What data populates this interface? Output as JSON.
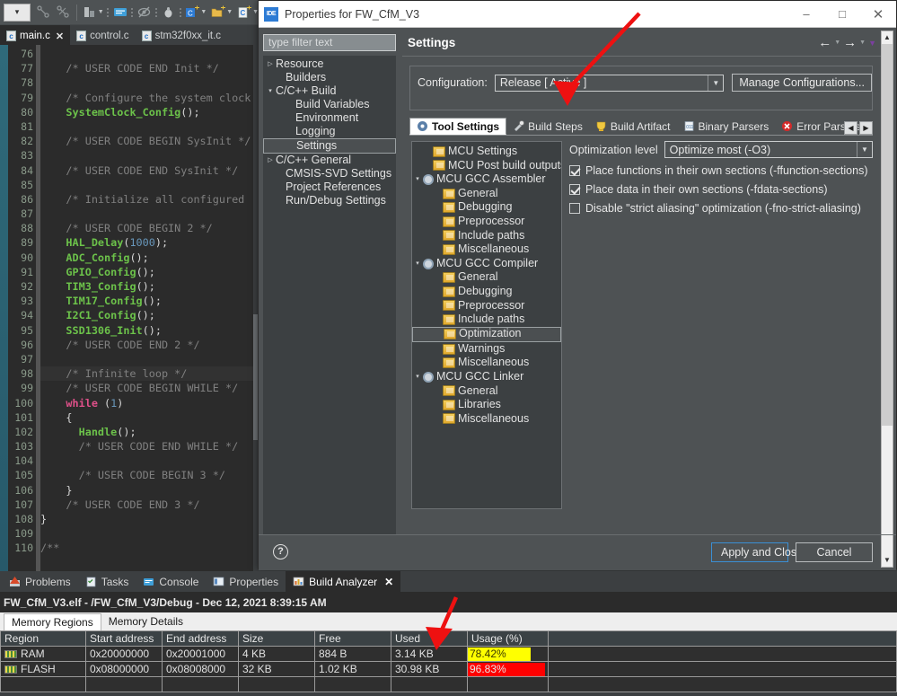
{
  "ide": {
    "toolbar_icons": [
      "perspective-combo",
      "link-with-editor-icon",
      "collapse-all-icon",
      "build-icon",
      "console-icon",
      "hide-icon",
      "debug-icon",
      "new-c-project-icon",
      "new-folder-icon",
      "new-c-file-icon"
    ],
    "tabs": [
      {
        "label": "main.c",
        "active": true,
        "closable": true
      },
      {
        "label": "control.c",
        "active": false,
        "closable": false
      },
      {
        "label": "stm32f0xx_it.c",
        "active": false,
        "closable": false
      }
    ],
    "code": {
      "first_line": 76,
      "lines": [
        {
          "n": 76,
          "text": "",
          "hl": false
        },
        {
          "n": 77,
          "text": "    /* USER CODE END Init */",
          "hl": false
        },
        {
          "n": 78,
          "text": "",
          "hl": false
        },
        {
          "n": 79,
          "text": "    /* Configure the system clock",
          "hl": false
        },
        {
          "n": 80,
          "text": "    SystemClock_Config();",
          "hl": false
        },
        {
          "n": 81,
          "text": "",
          "hl": false
        },
        {
          "n": 82,
          "text": "    /* USER CODE BEGIN SysInit */",
          "hl": false
        },
        {
          "n": 83,
          "text": "",
          "hl": false
        },
        {
          "n": 84,
          "text": "    /* USER CODE END SysInit */",
          "hl": false
        },
        {
          "n": 85,
          "text": "",
          "hl": false
        },
        {
          "n": 86,
          "text": "    /* Initialize all configured",
          "hl": false
        },
        {
          "n": 87,
          "text": "",
          "hl": false
        },
        {
          "n": 88,
          "text": "    /* USER CODE BEGIN 2 */",
          "hl": false
        },
        {
          "n": 89,
          "text": "    HAL_Delay(1000);",
          "hl": false
        },
        {
          "n": 90,
          "text": "    ADC_Config();",
          "hl": false
        },
        {
          "n": 91,
          "text": "    GPIO_Config();",
          "hl": false
        },
        {
          "n": 92,
          "text": "    TIM3_Config();",
          "hl": false
        },
        {
          "n": 93,
          "text": "    TIM17_Config();",
          "hl": false
        },
        {
          "n": 94,
          "text": "    I2C1_Config();",
          "hl": false
        },
        {
          "n": 95,
          "text": "    SSD1306_Init();",
          "hl": false
        },
        {
          "n": 96,
          "text": "    /* USER CODE END 2 */",
          "hl": false
        },
        {
          "n": 97,
          "text": "",
          "hl": false
        },
        {
          "n": 98,
          "text": "    /* Infinite loop */",
          "hl": true
        },
        {
          "n": 99,
          "text": "    /* USER CODE BEGIN WHILE */",
          "hl": false
        },
        {
          "n": 100,
          "text": "    while (1)",
          "hl": false
        },
        {
          "n": 101,
          "text": "    {",
          "hl": false
        },
        {
          "n": 102,
          "text": "      Handle();",
          "hl": false
        },
        {
          "n": 103,
          "text": "      /* USER CODE END WHILE */",
          "hl": false
        },
        {
          "n": 104,
          "text": "",
          "hl": false
        },
        {
          "n": 105,
          "text": "      /* USER CODE BEGIN 3 */",
          "hl": false
        },
        {
          "n": 106,
          "text": "    }",
          "hl": false
        },
        {
          "n": 107,
          "text": "    /* USER CODE END 3 */",
          "hl": false
        },
        {
          "n": 108,
          "text": "}",
          "hl": false
        },
        {
          "n": 109,
          "text": "",
          "hl": false
        },
        {
          "n": 110,
          "text": "/**",
          "hl": false
        }
      ]
    }
  },
  "dialog": {
    "title": "Properties for FW_CfM_V3",
    "icon": "IDE",
    "window_buttons": {
      "minimize": "–",
      "maximize": "□",
      "close": "✕"
    },
    "filter_placeholder": "type filter text",
    "tree": [
      {
        "label": "Resource",
        "indent": 0,
        "twisty": "collapsed",
        "selected": false
      },
      {
        "label": "Builders",
        "indent": 1,
        "twisty": "none",
        "selected": false
      },
      {
        "label": "C/C++ Build",
        "indent": 0,
        "twisty": "expanded",
        "selected": false
      },
      {
        "label": "Build Variables",
        "indent": 2,
        "twisty": "none",
        "selected": false
      },
      {
        "label": "Environment",
        "indent": 2,
        "twisty": "none",
        "selected": false
      },
      {
        "label": "Logging",
        "indent": 2,
        "twisty": "none",
        "selected": false
      },
      {
        "label": "Settings",
        "indent": 2,
        "twisty": "none",
        "selected": true
      },
      {
        "label": "C/C++ General",
        "indent": 0,
        "twisty": "collapsed",
        "selected": false
      },
      {
        "label": "CMSIS-SVD Settings",
        "indent": 1,
        "twisty": "none",
        "selected": false
      },
      {
        "label": "Project References",
        "indent": 1,
        "twisty": "none",
        "selected": false
      },
      {
        "label": "Run/Debug Settings",
        "indent": 1,
        "twisty": "none",
        "selected": false
      }
    ],
    "page_title": "Settings",
    "nav": {
      "back": "←",
      "forward": "→",
      "menu": "▼"
    },
    "configuration": {
      "label": "Configuration:",
      "value": "Release  [ Active ]",
      "manage_button": "Manage Configurations..."
    },
    "tabs": [
      {
        "label": "Tool Settings",
        "icon": "tool-settings-icon",
        "active": true
      },
      {
        "label": "Build Steps",
        "icon": "build-steps-icon",
        "active": false
      },
      {
        "label": "Build Artifact",
        "icon": "build-artifact-icon",
        "active": false
      },
      {
        "label": "Binary Parsers",
        "icon": "binary-parsers-icon",
        "active": false
      },
      {
        "label": "Error Parsers",
        "icon": "error-parsers-icon",
        "active": false
      }
    ],
    "tools_tree": [
      {
        "label": "MCU Settings",
        "indent": 1,
        "twisty": "none",
        "icon": "folder",
        "selected": false
      },
      {
        "label": "MCU Post build outputs",
        "indent": 1,
        "twisty": "none",
        "icon": "folder",
        "selected": false
      },
      {
        "label": "MCU GCC Assembler",
        "indent": 0,
        "twisty": "expanded",
        "icon": "gear",
        "selected": false
      },
      {
        "label": "General",
        "indent": 2,
        "twisty": "none",
        "icon": "folder",
        "selected": false
      },
      {
        "label": "Debugging",
        "indent": 2,
        "twisty": "none",
        "icon": "folder",
        "selected": false
      },
      {
        "label": "Preprocessor",
        "indent": 2,
        "twisty": "none",
        "icon": "folder",
        "selected": false
      },
      {
        "label": "Include paths",
        "indent": 2,
        "twisty": "none",
        "icon": "folder",
        "selected": false
      },
      {
        "label": "Miscellaneous",
        "indent": 2,
        "twisty": "none",
        "icon": "folder",
        "selected": false
      },
      {
        "label": "MCU GCC Compiler",
        "indent": 0,
        "twisty": "expanded",
        "icon": "gear",
        "selected": false
      },
      {
        "label": "General",
        "indent": 2,
        "twisty": "none",
        "icon": "folder",
        "selected": false
      },
      {
        "label": "Debugging",
        "indent": 2,
        "twisty": "none",
        "icon": "folder",
        "selected": false
      },
      {
        "label": "Preprocessor",
        "indent": 2,
        "twisty": "none",
        "icon": "folder",
        "selected": false
      },
      {
        "label": "Include paths",
        "indent": 2,
        "twisty": "none",
        "icon": "folder",
        "selected": false
      },
      {
        "label": "Optimization",
        "indent": 2,
        "twisty": "none",
        "icon": "folder",
        "selected": true
      },
      {
        "label": "Warnings",
        "indent": 2,
        "twisty": "none",
        "icon": "folder",
        "selected": false
      },
      {
        "label": "Miscellaneous",
        "indent": 2,
        "twisty": "none",
        "icon": "folder",
        "selected": false
      },
      {
        "label": "MCU GCC Linker",
        "indent": 0,
        "twisty": "expanded",
        "icon": "gear",
        "selected": false
      },
      {
        "label": "General",
        "indent": 2,
        "twisty": "none",
        "icon": "folder",
        "selected": false
      },
      {
        "label": "Libraries",
        "indent": 2,
        "twisty": "none",
        "icon": "folder",
        "selected": false
      },
      {
        "label": "Miscellaneous",
        "indent": 2,
        "twisty": "none",
        "icon": "folder",
        "selected": false
      }
    ],
    "optimization": {
      "level_label": "Optimization level",
      "level_value": "Optimize most (-O3)",
      "checkboxes": [
        {
          "label": "Place functions in their own sections (-ffunction-sections)",
          "checked": true
        },
        {
          "label": "Place data in their own sections (-fdata-sections)",
          "checked": true
        },
        {
          "label": "Disable \"strict aliasing\" optimization (-fno-strict-aliasing)",
          "checked": false
        }
      ]
    },
    "footer": {
      "help": "?",
      "apply_label": "Apply and Close",
      "cancel_label": "Cancel"
    }
  },
  "bottom": {
    "tabs": [
      {
        "label": "Problems",
        "icon": "problems-icon",
        "active": false,
        "closable": false
      },
      {
        "label": "Tasks",
        "icon": "tasks-icon",
        "active": false,
        "closable": false
      },
      {
        "label": "Console",
        "icon": "console-icon",
        "active": false,
        "closable": false
      },
      {
        "label": "Properties",
        "icon": "properties-icon",
        "active": false,
        "closable": false
      },
      {
        "label": "Build Analyzer",
        "icon": "build-analyzer-icon",
        "active": true,
        "closable": true
      }
    ],
    "title": "FW_CfM_V3.elf - /FW_CfM_V3/Debug - Dec 12, 2021 8:39:15 AM",
    "subtabs": [
      {
        "label": "Memory Regions",
        "active": true
      },
      {
        "label": "Memory Details",
        "active": false
      }
    ],
    "table": {
      "columns": [
        "Region",
        "Start address",
        "End address",
        "Size",
        "Free",
        "Used",
        "Usage (%)",
        ""
      ],
      "rows": [
        {
          "region": "RAM",
          "start": "0x20000000",
          "end": "0x20001000",
          "size": "4 KB",
          "free": "884 B",
          "used": "3.14 KB",
          "usage_text": "78.42%",
          "usage_pct": 78.42,
          "usage_color": "#ffff00",
          "text_dark": true
        },
        {
          "region": "FLASH",
          "start": "0x08000000",
          "end": "0x08008000",
          "size": "32 KB",
          "free": "1.02 KB",
          "used": "30.98 KB",
          "usage_text": "96.83%",
          "usage_pct": 96.83,
          "usage_color": "#ff0000",
          "text_dark": false
        }
      ]
    }
  },
  "annotations": {
    "arrow_color": "#ee1111",
    "arrows": [
      {
        "name": "arrow-to-configuration"
      },
      {
        "name": "arrow-to-usage-column"
      }
    ]
  }
}
